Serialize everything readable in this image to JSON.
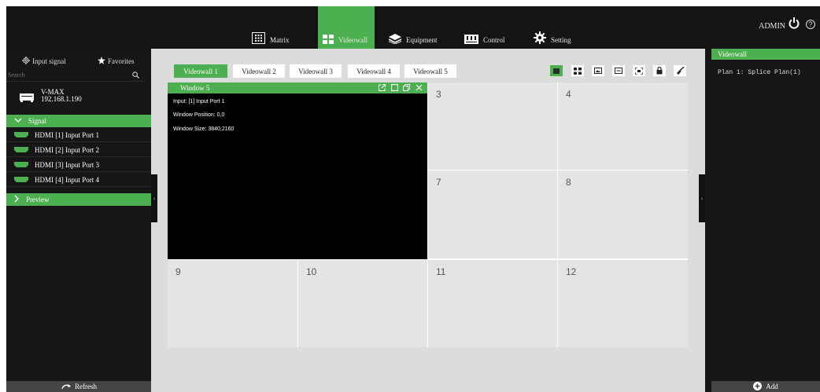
{
  "nav": {
    "items": [
      {
        "label": "Matrix",
        "icon": "matrix-icon"
      },
      {
        "label": "Videowall",
        "icon": "videowall-grid-icon"
      },
      {
        "label": "Equipment",
        "icon": "layers-icon"
      },
      {
        "label": "Control",
        "icon": "control-panel-icon"
      },
      {
        "label": "Setting",
        "icon": "gear-icon"
      }
    ],
    "active": "Videowall",
    "user": "ADMIN"
  },
  "left": {
    "tabs": [
      {
        "label": "Input signal",
        "icon": "gear-icon"
      },
      {
        "label": "Favorites",
        "icon": "star-icon"
      }
    ],
    "search_placeholder": "Search",
    "device": {
      "name": "V-MAX",
      "ip": "192.168.1.190",
      "icon": "device-box-icon"
    },
    "signal_header": "Signal",
    "signals": [
      "HDMI [1] Input Port 1",
      "HDMI [2] Input Port 2",
      "HDMI [3] Input Port 3",
      "HDMI [4] Input Port 4"
    ],
    "preview_header": "Preview",
    "refresh_label": "Refresh"
  },
  "center": {
    "tabs": [
      "Videowall 1",
      "Videowall 2",
      "Videowall 3",
      "Videowall 4",
      "Videowall 5"
    ],
    "active_tab": "Videowall 1",
    "toolbar_icons": [
      "single-screen-icon",
      "grid-icon",
      "picture-icon",
      "text-icon",
      "fullscreen-icon",
      "lock-icon",
      "clear-brush-icon"
    ],
    "window": {
      "title": "Window 5",
      "input": "Input: [1] Input Port 1",
      "position": "Window Position: 0,0",
      "size": "Window Size: 3840,2160"
    },
    "cells": [
      "3",
      "4",
      "7",
      "8",
      "9",
      "10",
      "11",
      "12"
    ]
  },
  "right": {
    "header": "Videowall",
    "plan": "Plan 1: Splice Plan(1)",
    "add_label": "Add"
  },
  "colors": {
    "accent": "#4caf50",
    "panel": "#161616",
    "canvas": "#dcdcdc"
  }
}
